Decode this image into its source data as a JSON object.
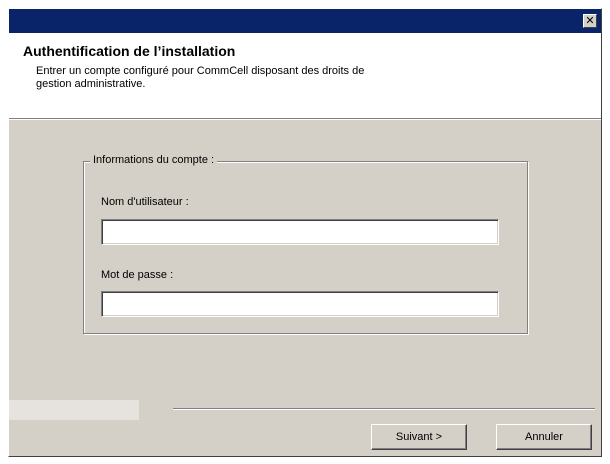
{
  "titlebar": {
    "close_glyph": "✕",
    "close_icon": "close-icon"
  },
  "header": {
    "title": "Authentification de l’installation",
    "description": "Entrer un compte configuré pour CommCell disposant des droits de gestion administrative."
  },
  "account_group": {
    "legend": "Informations du compte :",
    "username": {
      "label": "Nom d'utilisateur :",
      "value": "",
      "placeholder": ""
    },
    "password": {
      "label": "Mot de passe :",
      "value": "",
      "placeholder": ""
    }
  },
  "footer": {
    "next_label": "Suivant >",
    "cancel_label": "Annuler"
  },
  "colors": {
    "titlebar": "#0a246a",
    "dialog_bg": "#d4d0c8",
    "header_bg": "#ffffff"
  }
}
